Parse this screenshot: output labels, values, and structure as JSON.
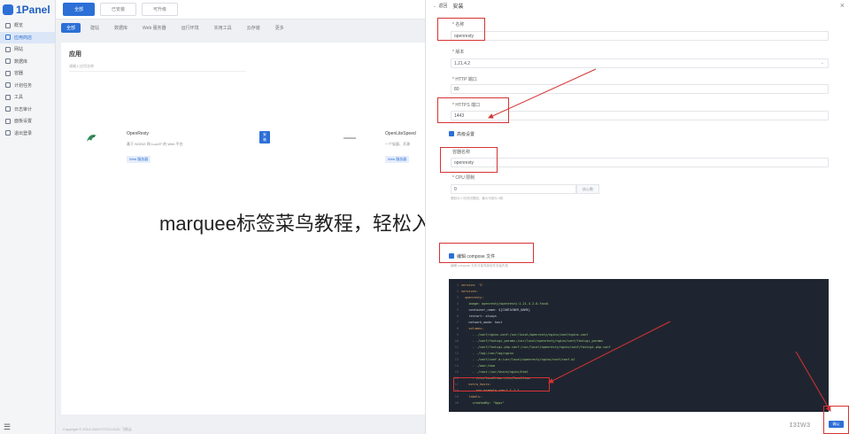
{
  "app": {
    "logo_text": "1Panel",
    "sidebar_items": [
      {
        "label": "概览",
        "active": false
      },
      {
        "label": "应用商店",
        "active": true
      },
      {
        "label": "网站",
        "active": false
      },
      {
        "label": "数据库",
        "active": false
      },
      {
        "label": "容器",
        "active": false
      },
      {
        "label": "计划任务",
        "active": false
      },
      {
        "label": "工具",
        "active": false
      },
      {
        "label": "日志审计",
        "active": false
      },
      {
        "label": "面板设置",
        "active": false
      },
      {
        "label": "退出登录",
        "active": false
      }
    ],
    "sidebar_foot": "☰"
  },
  "main": {
    "top_tabs": [
      {
        "label": "全部",
        "active": true
      },
      {
        "label": "已安装",
        "active": false
      },
      {
        "label": "可升级",
        "active": false
      }
    ],
    "sub_tabs": [
      {
        "label": "全部",
        "active": true
      },
      {
        "label": "建站",
        "active": false
      },
      {
        "label": "数据库",
        "active": false
      },
      {
        "label": "Web 服务器",
        "active": false
      },
      {
        "label": "运行环境",
        "active": false
      },
      {
        "label": "实用工具",
        "active": false
      },
      {
        "label": "云存储",
        "active": false
      },
      {
        "label": "更多",
        "active": false
      }
    ],
    "apps_title": "应用",
    "search_placeholder": "请输入应用名称",
    "apps": [
      {
        "name": "OpenResty",
        "desc": "基于 NGINX 和 LuaJIT 的 Web 平台",
        "tag": "Web 服务器",
        "install": "安装"
      },
      {
        "name": "OpenLiteSpeed",
        "desc": "一个轻量、开源",
        "tag": "Web 服务器"
      }
    ],
    "footer": "Copyright © 2014-2023 FIT2CLOUD 飞致云"
  },
  "overlay_text": "marquee标签菜鸟教程，轻松入门，marquee标签基础教程",
  "drawer": {
    "back_label": "← 返回",
    "title": "安装",
    "close": "×",
    "fields": {
      "name_label": "* 名称",
      "name_value": "openresty",
      "version_label": "* 版本",
      "version_value": "1.21.4.2",
      "http_port_label": "* HTTP 端口",
      "http_port_value": "80",
      "https_port_label": "* HTTPS 端口",
      "https_port_value": "1443",
      "advanced_label": "高级设置",
      "container_name_label": "容器名称",
      "container_name_value": "openresty",
      "cpu_label": "* CPU 限制",
      "cpu_value": "0",
      "cpu_unit": "核心数",
      "cpu_hint": "限制为 0 则关闭限制，最大可用为 4核",
      "compose_label": "编辑 compose 文件",
      "compose_hint": "编辑 compose 文件可能导致软件安装失败"
    },
    "code_lines": [
      {
        "n": "1",
        "t": "version: '3'",
        "c": "k"
      },
      {
        "n": "2",
        "t": "services:",
        "c": "k"
      },
      {
        "n": "3",
        "t": "  openresty:",
        "c": "k"
      },
      {
        "n": "4",
        "t": "    image: openresty/openresty:1.21.4.2-0-focal",
        "c": "s"
      },
      {
        "n": "5",
        "t": "    container_name: ${CONTAINER_NAME}",
        "c": ""
      },
      {
        "n": "6",
        "t": "    restart: always",
        "c": ""
      },
      {
        "n": "7",
        "t": "    network_mode: host",
        "c": ""
      },
      {
        "n": "8",
        "t": "    volumes:",
        "c": "k"
      },
      {
        "n": "9",
        "t": "      - ./conf/nginx.conf:/usr/local/openresty/nginx/conf/nginx.conf",
        "c": "s"
      },
      {
        "n": "10",
        "t": "      - ./conf/fastcgi_params:/usr/local/openresty/nginx/conf/fastcgi_params",
        "c": "s"
      },
      {
        "n": "11",
        "t": "      - ./conf/fastcgi-php.conf:/usr/local/openresty/nginx/conf/fastcgi-php.conf",
        "c": "s"
      },
      {
        "n": "12",
        "t": "      - ./log:/var/log/nginx",
        "c": "s"
      },
      {
        "n": "13",
        "t": "      - ./conf/conf.d:/usr/local/openresty/nginx/conf/conf.d/",
        "c": "s"
      },
      {
        "n": "14",
        "t": "      - ./www:/www",
        "c": "s"
      },
      {
        "n": "15",
        "t": "      - ./root:/usr/share/nginx/html",
        "c": "s"
      },
      {
        "n": "16",
        "t": "      - /etc/localtime:/etc/localtime",
        "c": "s"
      },
      {
        "n": "17",
        "t": "    extra_hosts:",
        "c": "k"
      },
      {
        "n": "18",
        "t": "      - www.example.com:1.1.1.1",
        "c": "v"
      },
      {
        "n": "19",
        "t": "    labels:",
        "c": "k"
      },
      {
        "n": "20",
        "t": "      createdBy: \"Apps\"",
        "c": "s"
      }
    ],
    "confirm_label": "确认",
    "watermark": "ɪɜɪwɜ"
  }
}
